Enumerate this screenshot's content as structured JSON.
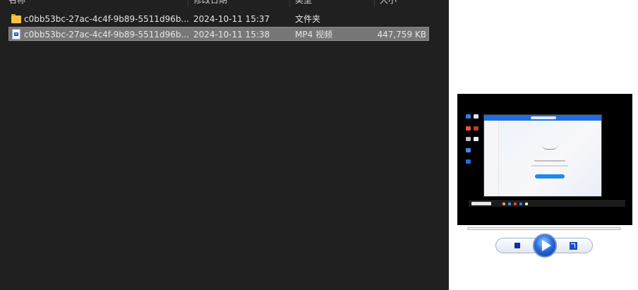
{
  "columns": {
    "name": "名称",
    "modified": "修改日期",
    "type": "类型",
    "size": "大小"
  },
  "files": [
    {
      "name": "c0bb53bc-27ac-4c4f-9b89-5511d96b...",
      "modified": "2024-10-11 15:37",
      "type": "文件夹",
      "size": "",
      "icon": "folder-icon",
      "selected": false
    },
    {
      "name": "c0bb53bc-27ac-4c4f-9b89-5511d96b...",
      "modified": "2024-10-11 15:38",
      "type": "MP4 视频",
      "size": "447,759 KB",
      "icon": "video-file-icon",
      "selected": true
    }
  ],
  "colors": {
    "background": "#202020",
    "selection": "#777777",
    "folder": "#f5c243",
    "player_accent": "#1f63c8"
  }
}
